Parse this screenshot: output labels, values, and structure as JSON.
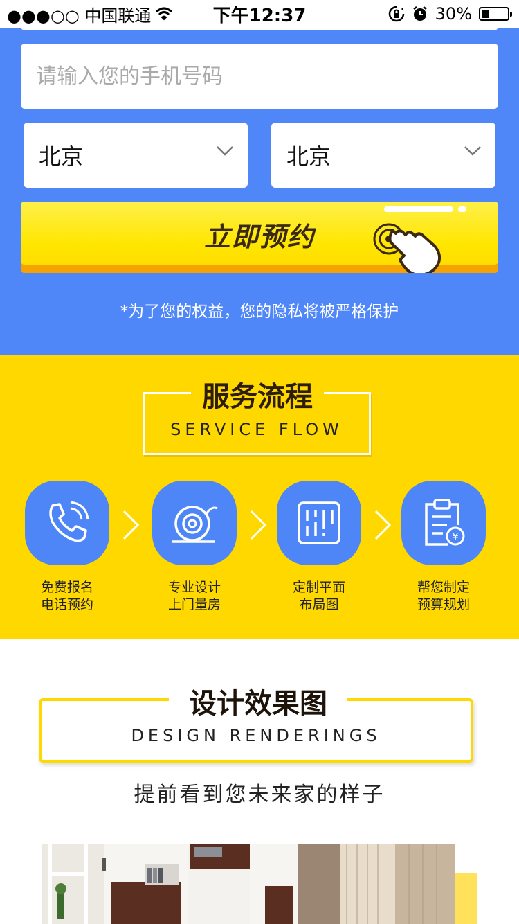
{
  "status_bar": {
    "carrier": "●●●○○ 中国联通",
    "time": "下午12:37",
    "battery": "30%",
    "battery_level": 0.3
  },
  "form": {
    "phone_placeholder": "请输入您的手机号码",
    "select_1": "北京",
    "select_2": "北京",
    "book_button": "立即预约",
    "privacy_note": "*为了您的权益，您的隐私将被严格保护"
  },
  "service_flow": {
    "title": "服务流程",
    "subtitle": "SERVICE FLOW",
    "steps": [
      {
        "line1": "免费报名",
        "line2": "电话预约",
        "icon": "phone-icon"
      },
      {
        "line1": "专业设计",
        "line2": "上门量房",
        "icon": "tape-measure-icon"
      },
      {
        "line1": "定制平面",
        "line2": "布局图",
        "icon": "floor-plan-icon"
      },
      {
        "line1": "帮您制定",
        "line2": "预算规划",
        "icon": "budget-clipboard-icon"
      }
    ]
  },
  "design_renderings": {
    "title": "设计效果图",
    "subtitle": "DESIGN RENDERINGS",
    "tagline": "提前看到您未来家的样子"
  },
  "colors": {
    "blue": "#5087f8",
    "yellow": "#ffd800",
    "button_yellow": "#ffe600",
    "button_shadow": "#f6a200"
  }
}
